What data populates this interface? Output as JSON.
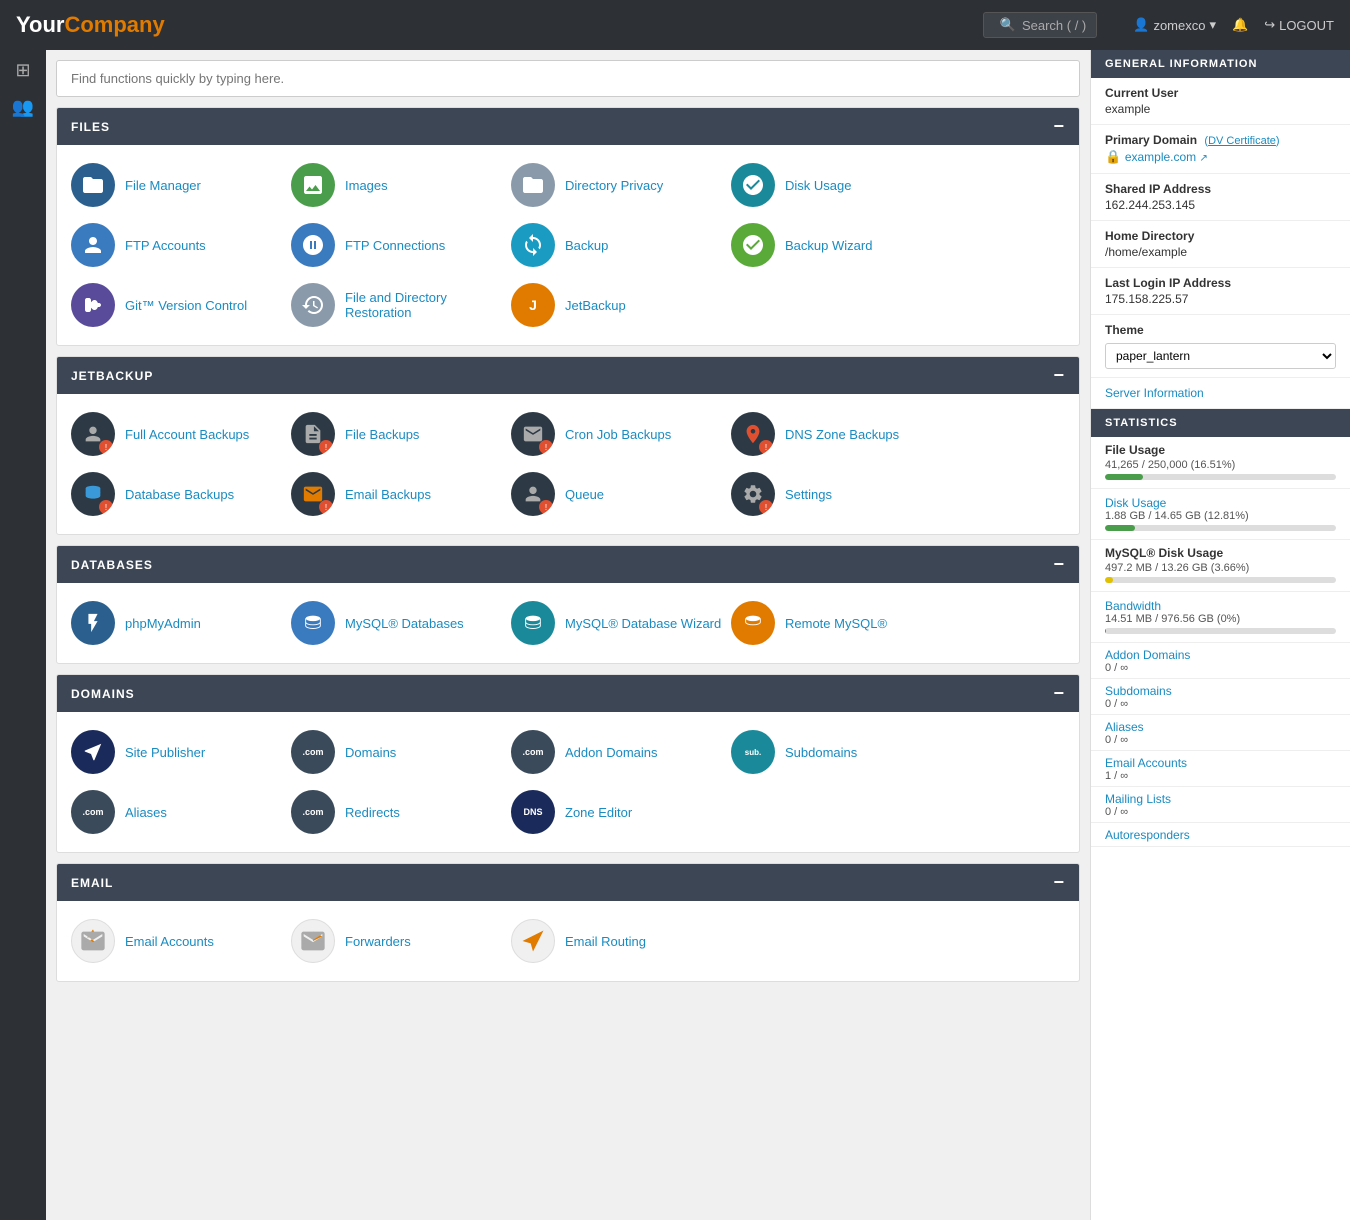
{
  "header": {
    "logo_your": "Your",
    "logo_company": "Company",
    "search_label": "Search ( / )",
    "user": "zomexco",
    "logout_label": "LOGOUT"
  },
  "search_bar": {
    "placeholder": "Find functions quickly by typing here."
  },
  "sections": {
    "files": {
      "title": "FILES",
      "items": [
        {
          "label": "File Manager",
          "icon": "📁",
          "color": "ic-blue-dark"
        },
        {
          "label": "Images",
          "icon": "🖼",
          "color": "ic-green"
        },
        {
          "label": "Directory Privacy",
          "icon": "📂",
          "color": "ic-gray"
        },
        {
          "label": "Disk Usage",
          "icon": "💾",
          "color": "ic-teal"
        },
        {
          "label": "FTP Accounts",
          "icon": "👤",
          "color": "ic-blue"
        },
        {
          "label": "FTP Connections",
          "icon": "🔗",
          "color": "ic-blue"
        },
        {
          "label": "Backup",
          "icon": "🔄",
          "color": "ic-cyan"
        },
        {
          "label": "Backup Wizard",
          "icon": "🧙",
          "color": "ic-green"
        },
        {
          "label": "Git™ Version Control",
          "icon": "⑆",
          "color": "ic-purple"
        },
        {
          "label": "File and Directory Restoration",
          "icon": "📋",
          "color": "ic-gray"
        },
        {
          "label": "JetBackup",
          "icon": "J",
          "color": "ic-orange"
        }
      ]
    },
    "jetbackup": {
      "title": "JETBACKUP",
      "items": [
        {
          "label": "Full Account Backups",
          "icon": "👤",
          "color": "ic-dark",
          "badge": true
        },
        {
          "label": "File Backups",
          "icon": "📄",
          "color": "ic-dark",
          "badge": true
        },
        {
          "label": "Cron Job Backups",
          "icon": "📬",
          "color": "ic-dark",
          "badge": true
        },
        {
          "label": "DNS Zone Backups",
          "icon": "📍",
          "color": "ic-dark",
          "badge": true
        },
        {
          "label": "Database Backups",
          "icon": "🗄",
          "color": "ic-dark",
          "badge": true
        },
        {
          "label": "Email Backups",
          "icon": "✉",
          "color": "ic-dark",
          "badge": true
        },
        {
          "label": "Queue",
          "icon": "👤",
          "color": "ic-dark",
          "badge": true
        },
        {
          "label": "Settings",
          "icon": "⚙",
          "color": "ic-dark",
          "badge": true
        }
      ]
    },
    "databases": {
      "title": "DATABASES",
      "items": [
        {
          "label": "phpMyAdmin",
          "icon": "⚡",
          "color": "ic-blue-dark"
        },
        {
          "label": "MySQL® Databases",
          "icon": "🗄",
          "color": "ic-blue"
        },
        {
          "label": "MySQL® Database Wizard",
          "icon": "🗄",
          "color": "ic-teal"
        },
        {
          "label": "Remote MySQL®",
          "icon": "🗄",
          "color": "ic-orange"
        }
      ]
    },
    "domains": {
      "title": "DOMAINS",
      "items": [
        {
          "label": "Site Publisher",
          "icon": "✈",
          "color": "ic-navy"
        },
        {
          "label": "Domains",
          "icon": ".com",
          "color": "ic-dark2"
        },
        {
          "label": "Addon Domains",
          "icon": ".com",
          "color": "ic-dark2"
        },
        {
          "label": "Subdomains",
          "icon": "sub.",
          "color": "ic-teal"
        },
        {
          "label": "Aliases",
          "icon": ".com",
          "color": "ic-dark2"
        },
        {
          "label": "Redirects",
          "icon": ".com",
          "color": "ic-dark2"
        },
        {
          "label": "Zone Editor",
          "icon": "DNS",
          "color": "ic-navy"
        }
      ]
    },
    "email": {
      "title": "EMAIL",
      "items": [
        {
          "label": "Email Accounts",
          "icon": "✉",
          "color": "ic-orange"
        },
        {
          "label": "Forwarders",
          "icon": "✉",
          "color": "ic-orange"
        },
        {
          "label": "Email Routing",
          "icon": "✉",
          "color": "ic-orange"
        }
      ]
    }
  },
  "right_panel": {
    "general_info_title": "GENERAL INFORMATION",
    "current_user_label": "Current User",
    "current_user_value": "example",
    "primary_domain_label": "Primary Domain",
    "dv_cert_label": "DV Certificate",
    "domain_link": "example.com",
    "shared_ip_label": "Shared IP Address",
    "shared_ip_value": "162.244.253.145",
    "home_dir_label": "Home Directory",
    "home_dir_value": "/home/example",
    "last_login_label": "Last Login IP Address",
    "last_login_value": "175.158.225.57",
    "theme_label": "Theme",
    "theme_value": "paper_lantern",
    "server_info_label": "Server Information",
    "statistics_title": "STATISTICS",
    "file_usage_label": "File Usage",
    "file_usage_value": "41,265 / 250,000  (16.51%)",
    "file_usage_pct": 16.51,
    "disk_usage_label": "Disk Usage",
    "disk_usage_value": "1.88 GB / 14.65 GB  (12.81%)",
    "disk_usage_pct": 12.81,
    "mysql_disk_label": "MySQL® Disk Usage",
    "mysql_disk_value": "497.2 MB / 13.26 GB  (3.66%)",
    "mysql_disk_pct": 3.66,
    "bandwidth_label": "Bandwidth",
    "bandwidth_value": "14.51 MB / 976.56 GB  (0%)",
    "bandwidth_pct": 0.1,
    "addon_domains_label": "Addon Domains",
    "addon_domains_value": "0 / ∞",
    "subdomains_label": "Subdomains",
    "subdomains_value": "0 / ∞",
    "aliases_label": "Aliases",
    "aliases_value": "0 / ∞",
    "email_accounts_label": "Email Accounts",
    "email_accounts_value": "1 / ∞",
    "mailing_lists_label": "Mailing Lists",
    "mailing_lists_value": "0 / ∞",
    "autoresponders_label": "Autoresponders"
  }
}
